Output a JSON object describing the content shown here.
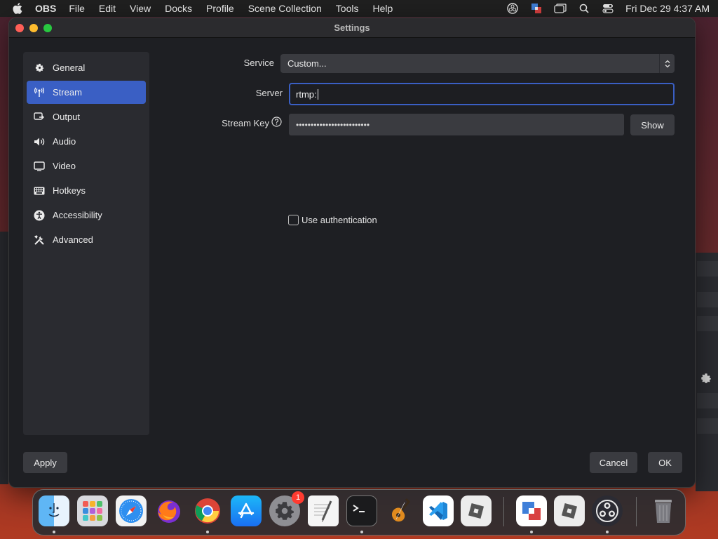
{
  "menubar": {
    "app_name": "OBS",
    "items": [
      "File",
      "Edit",
      "View",
      "Docks",
      "Profile",
      "Scene Collection",
      "Tools",
      "Help"
    ],
    "clock": "Fri Dec 29  4:37 AM",
    "tray_icons": [
      "obs-tray-icon",
      "vm-tray-icon",
      "window-tray-icon",
      "search-icon",
      "control-center-icon"
    ]
  },
  "window": {
    "title": "Settings"
  },
  "sidebar": {
    "items": [
      {
        "label": "General",
        "icon": "gear-icon"
      },
      {
        "label": "Stream",
        "icon": "antenna-icon",
        "active": true
      },
      {
        "label": "Output",
        "icon": "output-icon"
      },
      {
        "label": "Audio",
        "icon": "speaker-icon"
      },
      {
        "label": "Video",
        "icon": "monitor-icon"
      },
      {
        "label": "Hotkeys",
        "icon": "keyboard-icon"
      },
      {
        "label": "Accessibility",
        "icon": "accessibility-icon"
      },
      {
        "label": "Advanced",
        "icon": "tools-icon"
      }
    ]
  },
  "stream": {
    "service_label": "Service",
    "service_value": "Custom...",
    "server_label": "Server",
    "server_value": "rtmp:",
    "stream_key_label": "Stream Key",
    "stream_key_value": "•••••••••••••••••••••••••",
    "show_button": "Show",
    "use_auth_label": "Use authentication",
    "use_auth_checked": false
  },
  "footer": {
    "apply_button": "Apply",
    "cancel_button": "Cancel",
    "ok_button": "OK"
  },
  "dock": {
    "apps": [
      "finder-icon",
      "launchpad-icon",
      "safari-icon",
      "firefox-icon",
      "chrome-icon",
      "app-store-icon",
      "system-settings-icon",
      "textedit-icon",
      "terminal-icon",
      "garageband-icon",
      "vscode-icon",
      "roblox-icon",
      "vmware-icon",
      "roblox-studio-icon",
      "obs-icon",
      "trash-icon"
    ],
    "settings_badge": "1"
  },
  "colors": {
    "accent": "#3a5fc4",
    "window_bg": "#1e1f23",
    "panel_bg": "#2a2b30",
    "control_bg": "#3a3b40"
  }
}
